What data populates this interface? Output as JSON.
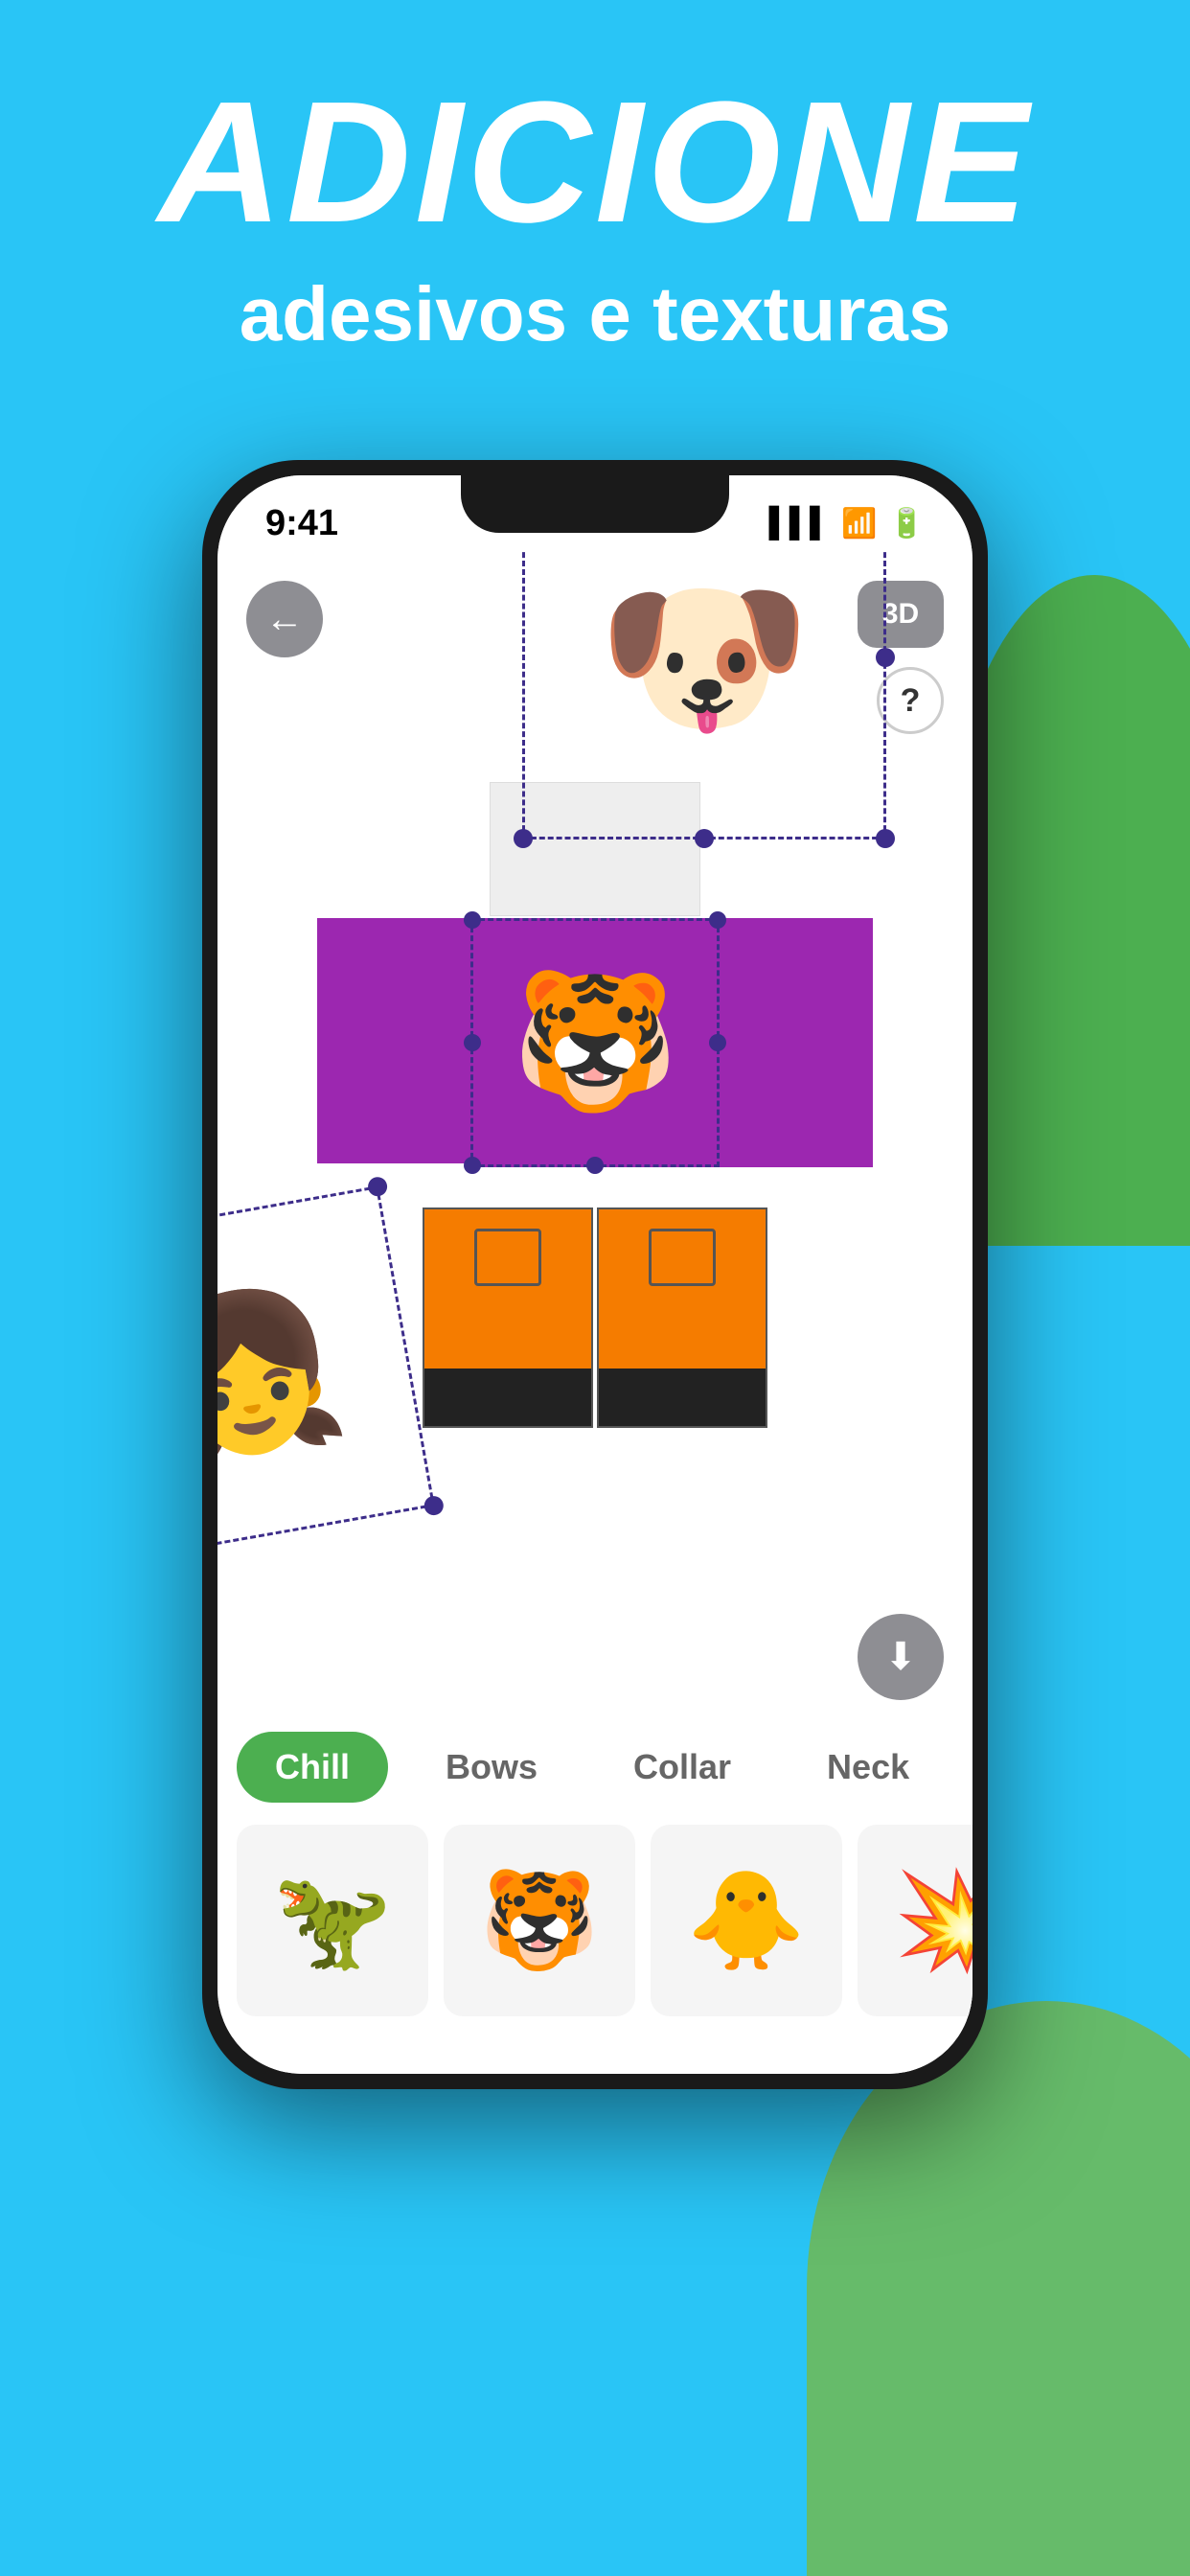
{
  "background_color": "#29c5f6",
  "header": {
    "title": "ADICIONE",
    "subtitle": "adesivos e texturas"
  },
  "status_bar": {
    "time": "9:41",
    "signal": "▌▌▌",
    "wifi": "WiFi",
    "battery": "🔋"
  },
  "phone": {
    "back_button": "←",
    "btn_3d_label": "3D",
    "btn_help_label": "?"
  },
  "stickers": {
    "dog_emoji": "🐶",
    "tiger_emoji": "🐯",
    "anime_emoji": "👧"
  },
  "categories": [
    {
      "id": "chill",
      "label": "Chill",
      "active": true
    },
    {
      "id": "bows",
      "label": "Bows",
      "active": false
    },
    {
      "id": "collar",
      "label": "Collar",
      "active": false
    },
    {
      "id": "neck",
      "label": "Neck",
      "active": false
    }
  ],
  "sticker_grid": [
    {
      "id": "dinosaur",
      "emoji": "🦖"
    },
    {
      "id": "tiger-face",
      "emoji": "🐯"
    },
    {
      "id": "duck",
      "emoji": "🐥"
    },
    {
      "id": "explosion",
      "emoji": "💥"
    }
  ],
  "download_button_icon": "⬇"
}
